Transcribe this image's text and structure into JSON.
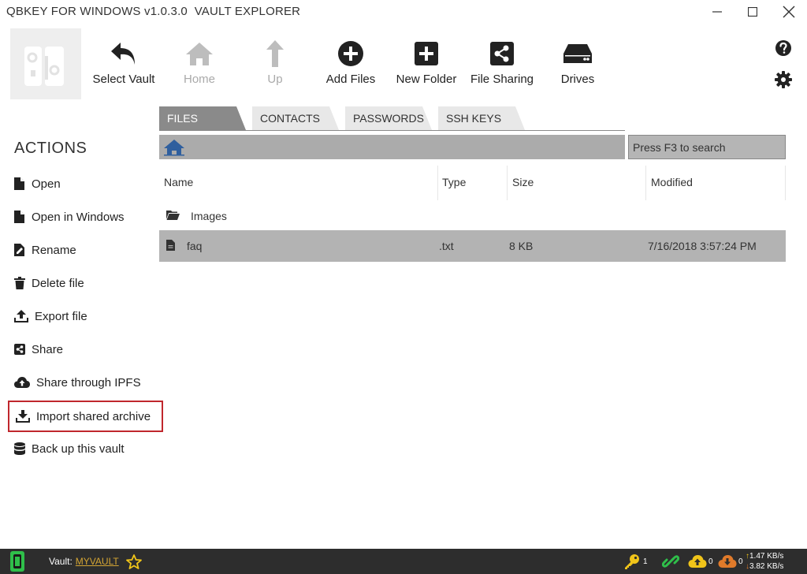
{
  "window": {
    "title": "QBKEY FOR WINDOWS v1.0.3.0  VAULT EXPLORER"
  },
  "toolbar": {
    "select_vault": "Select Vault",
    "home": "Home",
    "up": "Up",
    "add_files": "Add Files",
    "new_folder": "New Folder",
    "file_sharing": "File Sharing",
    "drives": "Drives"
  },
  "actions": {
    "title": "ACTIONS",
    "open": "Open",
    "open_in_windows": "Open in Windows",
    "rename": "Rename",
    "delete_file": "Delete file",
    "export_file": "Export file",
    "share": "Share",
    "share_ipfs": "Share through IPFS",
    "import_shared_archive": "Import shared archive",
    "back_up_vault": "Back up this vault"
  },
  "tabs": {
    "files": "FILES",
    "contacts": "CONTACTS",
    "passwords": "PASSWORDS",
    "ssh_keys": "SSH KEYS",
    "active": "FILES"
  },
  "search": {
    "placeholder": "Press F3 to search"
  },
  "file_list": {
    "columns": {
      "name": "Name",
      "type": "Type",
      "size": "Size",
      "modified": "Modified"
    },
    "rows": [
      {
        "kind": "folder",
        "name": "Images",
        "type": "",
        "size": "",
        "modified": ""
      },
      {
        "kind": "file",
        "name": "faq",
        "type": ".txt",
        "size": "8 KB",
        "modified": "7/16/2018 3:57:24 PM",
        "selected": true
      }
    ]
  },
  "status_bar": {
    "vault_label": "Vault:",
    "vault_name": "MYVAULT",
    "keys_count": "1",
    "upload_count": "0",
    "download_count": "0",
    "upload_speed": "1.47 KB/s",
    "download_speed": "3.82 KB/s"
  },
  "colors": {
    "active_tab": "#8a8a8a",
    "selected_row": "#b3b3b3",
    "highlight_border": "#c0272d",
    "status_bar": "#2d2d2d",
    "accent_yellow": "#f0c419",
    "accent_green": "#2fbf4a"
  }
}
